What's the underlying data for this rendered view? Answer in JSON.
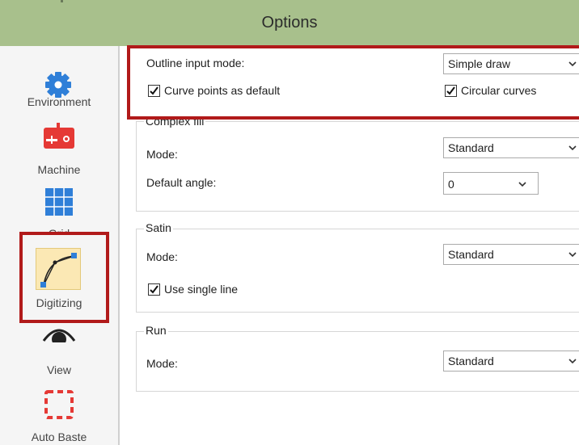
{
  "window": {
    "title": "Options"
  },
  "sidebar": {
    "items": [
      {
        "label": "Environment",
        "icon": "gear-icon"
      },
      {
        "label": "Machine",
        "icon": "sewing-machine-icon"
      },
      {
        "label": "Grid",
        "icon": "grid-icon"
      },
      {
        "label": "Digitizing",
        "icon": "bezier-curve-icon",
        "selected": true
      },
      {
        "label": "View",
        "icon": "eye-icon"
      },
      {
        "label": "Auto Baste",
        "icon": "dashed-square-icon"
      }
    ]
  },
  "outline": {
    "label": "Outline input mode:",
    "value": "Simple draw",
    "curve_points_label": "Curve points as default",
    "curve_points_checked": true,
    "circular_curves_label": "Circular curves",
    "circular_curves_checked": true
  },
  "complex_fill": {
    "title": "Complex fill",
    "mode_label": "Mode:",
    "mode_value": "Standard",
    "angle_label": "Default angle:",
    "angle_value": "0"
  },
  "satin": {
    "title": "Satin",
    "mode_label": "Mode:",
    "mode_value": "Standard",
    "single_line_label": "Use single line",
    "single_line_checked": true
  },
  "run": {
    "title": "Run",
    "mode_label": "Mode:",
    "mode_value": "Standard"
  },
  "colors": {
    "titlebar": "#a8c08c",
    "highlight_box": "#b11a1a",
    "selected_item": "#fbe8b4",
    "icon_blue": "#2f7fd8",
    "icon_red": "#e53935"
  }
}
